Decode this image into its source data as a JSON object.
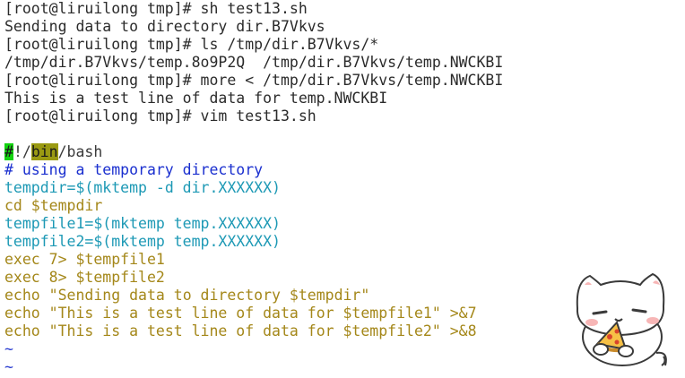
{
  "terminal": {
    "output": [
      "[root@liruilong tmp]# sh test13.sh",
      "Sending data to directory dir.B7Vkvs",
      "[root@liruilong tmp]# ls /tmp/dir.B7Vkvs/*",
      "/tmp/dir.B7Vkvs/temp.8o9P2Q  /tmp/dir.B7Vkvs/temp.NWCKBI",
      "[root@liruilong tmp]# more < /tmp/dir.B7Vkvs/temp.NWCKBI",
      "This is a test line of data for temp.NWCKBI",
      "[root@liruilong tmp]# vim test13.sh"
    ]
  },
  "editor": {
    "shebang": {
      "hash": "#",
      "bang_slash": "!/",
      "bin": "bin",
      "rest": "/bash"
    },
    "comment": "# using a temporary directory",
    "lines": [
      {
        "var": "tempdir",
        "rest": "=$(mktemp -d dir.XXXXXX)"
      },
      {
        "cmd": "cd",
        "rest": " $tempdir"
      },
      {
        "var": "tempfile1",
        "rest": "=$(mktemp temp.XXXXXX)"
      },
      {
        "var": "tempfile2",
        "rest": "=$(mktemp temp.XXXXXX)"
      },
      {
        "cmd": "exec",
        "rest": " 7> $tempfile1"
      },
      {
        "cmd": "exec",
        "rest": " 8> $tempfile2"
      },
      {
        "cmd": "echo",
        "rest": " \"Sending data to directory $tempdir\""
      },
      {
        "cmd": "echo",
        "rest": " \"This is a test line of data for $tempfile1\" >&7"
      },
      {
        "cmd": "echo",
        "rest": " \"This is a test line of data for $tempfile2\" >&8"
      }
    ],
    "tildes": [
      "~",
      "~"
    ]
  },
  "colors": {
    "comment": "#1a2fcf",
    "variable": "#1d99b5",
    "command": "#a48719",
    "highlight_green": "#13d30f",
    "highlight_olive": "#9a9a12"
  },
  "icons": {
    "sticker": "cat-eating-pizza-icon"
  }
}
